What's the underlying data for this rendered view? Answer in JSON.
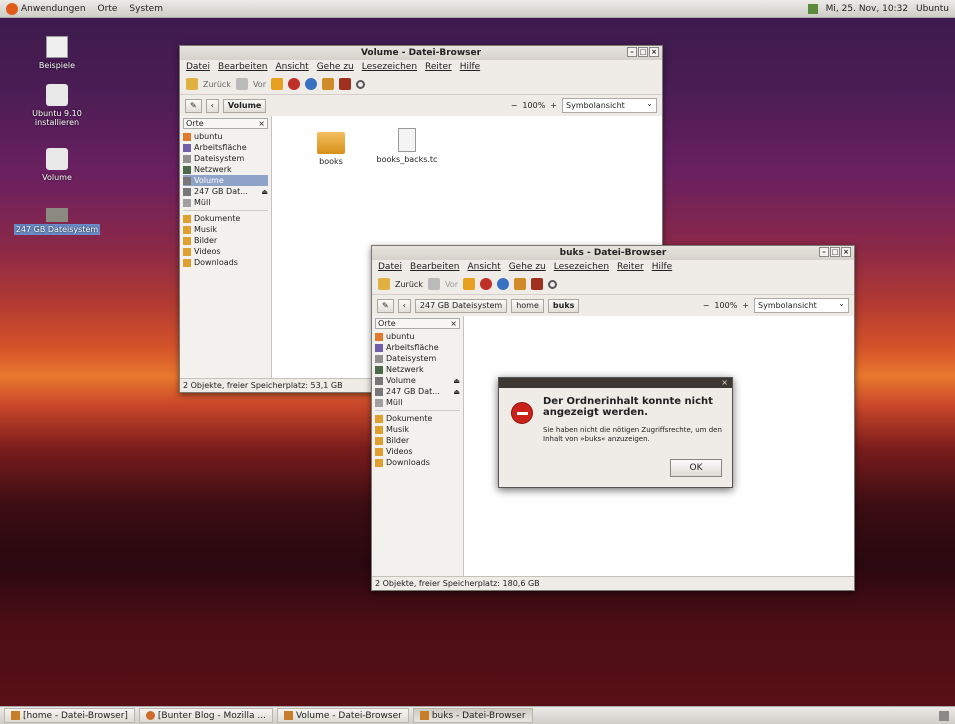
{
  "top_panel": {
    "menus": [
      "Anwendungen",
      "Orte",
      "System"
    ],
    "clock": "Mi, 25. Nov, 10:32",
    "user": "Ubuntu"
  },
  "desktop_icons": [
    "Beispiele",
    "Ubuntu 9.10 installieren",
    "Volume",
    "247 GB Dateisystem"
  ],
  "back_window": {
    "title": "Volume - Datei-Browser",
    "menus": [
      "Datei",
      "Bearbeiten",
      "Ansicht",
      "Gehe zu",
      "Lesezeichen",
      "Reiter",
      "Hilfe"
    ],
    "toolbar": [
      "Zurück",
      "Vor"
    ],
    "location": "Volume",
    "zoom": "100%",
    "view": "Symbolansicht",
    "sidebar_header": "Orte",
    "sidebar": [
      "ubuntu",
      "Arbeitsfläche",
      "Dateisystem",
      "Netzwerk",
      "Volume",
      "247 GB Dat...",
      "Müll",
      "Dokumente",
      "Musik",
      "Bilder",
      "Videos",
      "Downloads"
    ],
    "files": [
      "books",
      "books_backs.tc"
    ],
    "status": "2 Objekte, freier Speicherplatz: 53,1 GB"
  },
  "front_window": {
    "title": "buks - Datei-Browser",
    "menus": [
      "Datei",
      "Bearbeiten",
      "Ansicht",
      "Gehe zu",
      "Lesezeichen",
      "Reiter",
      "Hilfe"
    ],
    "toolbar": [
      "Zurück",
      "Vor"
    ],
    "crumbs": [
      "247 GB Dateisystem",
      "home",
      "buks"
    ],
    "zoom": "100%",
    "view": "Symbolansicht",
    "sidebar_header": "Orte",
    "sidebar": [
      "ubuntu",
      "Arbeitsfläche",
      "Dateisystem",
      "Netzwerk",
      "Volume",
      "247 GB Dat...",
      "Müll",
      "Dokumente",
      "Musik",
      "Bilder",
      "Videos",
      "Downloads"
    ],
    "status": "2 Objekte, freier Speicherplatz: 180,6 GB"
  },
  "dialog": {
    "heading": "Der Ordnerinhalt konnte nicht angezeigt werden.",
    "text": "Sie haben nicht die nötigen Zugriffsrechte, um den Inhalt von »buks« anzuzeigen.",
    "ok": "OK"
  },
  "taskbar": [
    "[home - Datei-Browser]",
    "[Bunter Blog - Mozilla ...",
    "Volume - Datei-Browser",
    "buks - Datei-Browser"
  ]
}
